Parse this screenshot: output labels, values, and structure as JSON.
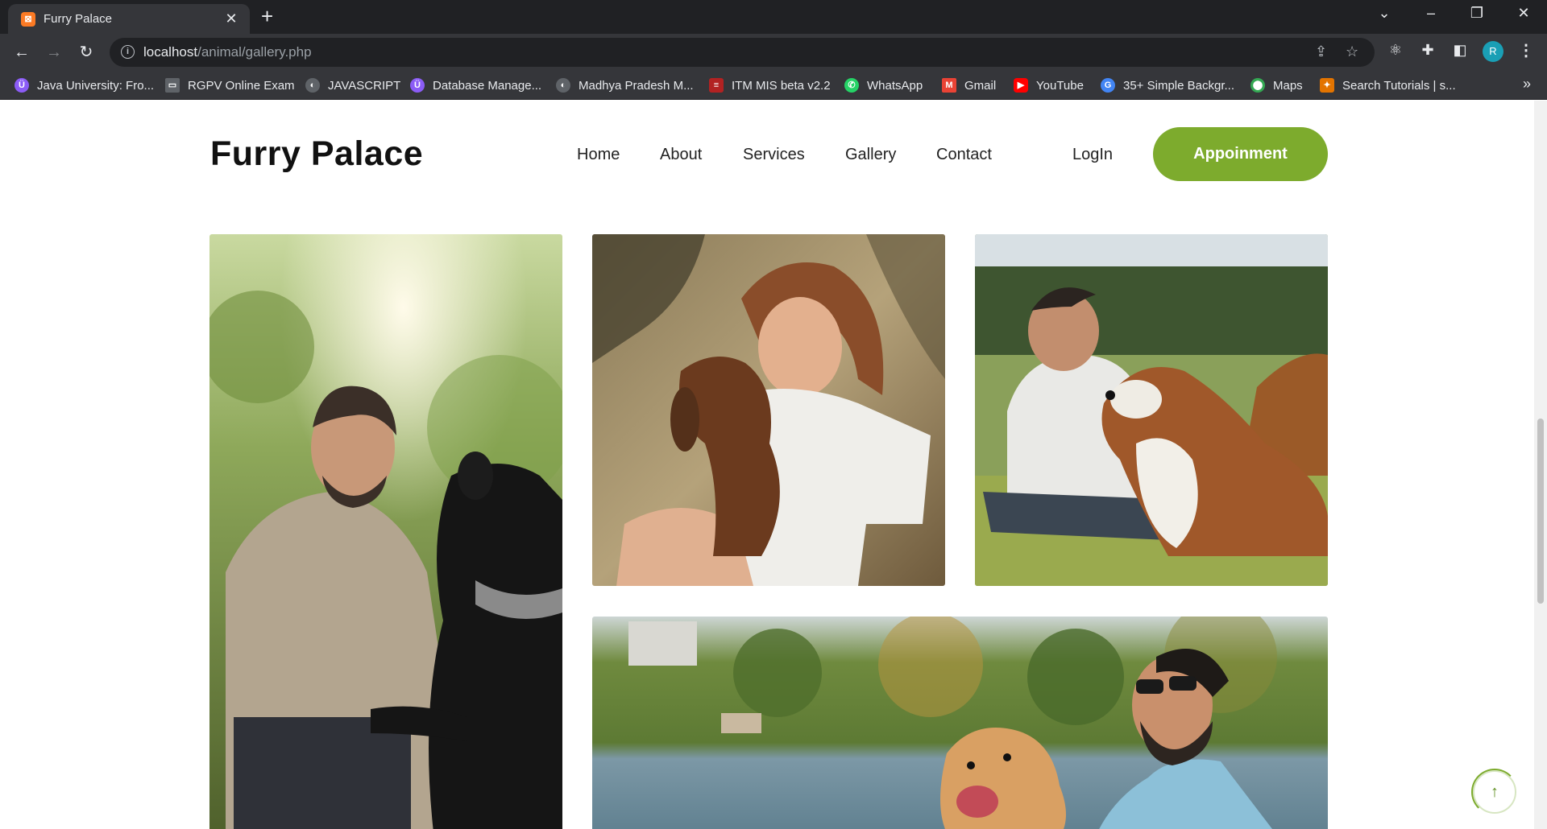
{
  "browser": {
    "tab_title": "Furry Palace",
    "tab_favicon_letter": "⊠",
    "url_host": "localhost",
    "url_path": "/animal/gallery.php",
    "profile_initial": "R",
    "bookmarks": [
      {
        "label": "Java University: Fro...",
        "icon": "university-icon",
        "color": "#8b5cf6"
      },
      {
        "label": "RGPV Online Exam",
        "icon": "monitor-icon",
        "color": "#5f6368"
      },
      {
        "label": "JAVASCRIPT",
        "icon": "globe-icon",
        "color": "#5f6368"
      },
      {
        "label": "Database Manage...",
        "icon": "university-icon",
        "color": "#8b5cf6"
      },
      {
        "label": "Madhya Pradesh M...",
        "icon": "globe-icon",
        "color": "#5f6368"
      },
      {
        "label": "ITM MIS beta v2.2",
        "icon": "itm-icon",
        "color": "#b22222"
      },
      {
        "label": "WhatsApp",
        "icon": "whatsapp-icon",
        "color": "#25d366"
      },
      {
        "label": "Gmail",
        "icon": "gmail-icon",
        "color": "#ea4335"
      },
      {
        "label": "YouTube",
        "icon": "youtube-icon",
        "color": "#ff0000"
      },
      {
        "label": "35+ Simple Backgr...",
        "icon": "google-icon",
        "color": "#4285f4"
      },
      {
        "label": "Maps",
        "icon": "maps-icon",
        "color": "#34a853"
      },
      {
        "label": "Search Tutorials | s...",
        "icon": "tutorials-icon",
        "color": "#e37400"
      }
    ]
  },
  "site": {
    "brand": "Furry Palace",
    "nav": [
      "Home",
      "About",
      "Services",
      "Gallery",
      "Contact"
    ],
    "login": "LogIn",
    "appointment": "Appoinment",
    "accent": "#7dab2d"
  },
  "gallery": [
    {
      "name": "man-with-black-dog-photo",
      "theme": "forest"
    },
    {
      "name": "woman-with-dachshund-photo",
      "theme": "warm"
    },
    {
      "name": "man-with-collie-photo",
      "theme": "meadow"
    },
    {
      "name": "man-with-golden-retriever-photo",
      "theme": "lake"
    }
  ]
}
